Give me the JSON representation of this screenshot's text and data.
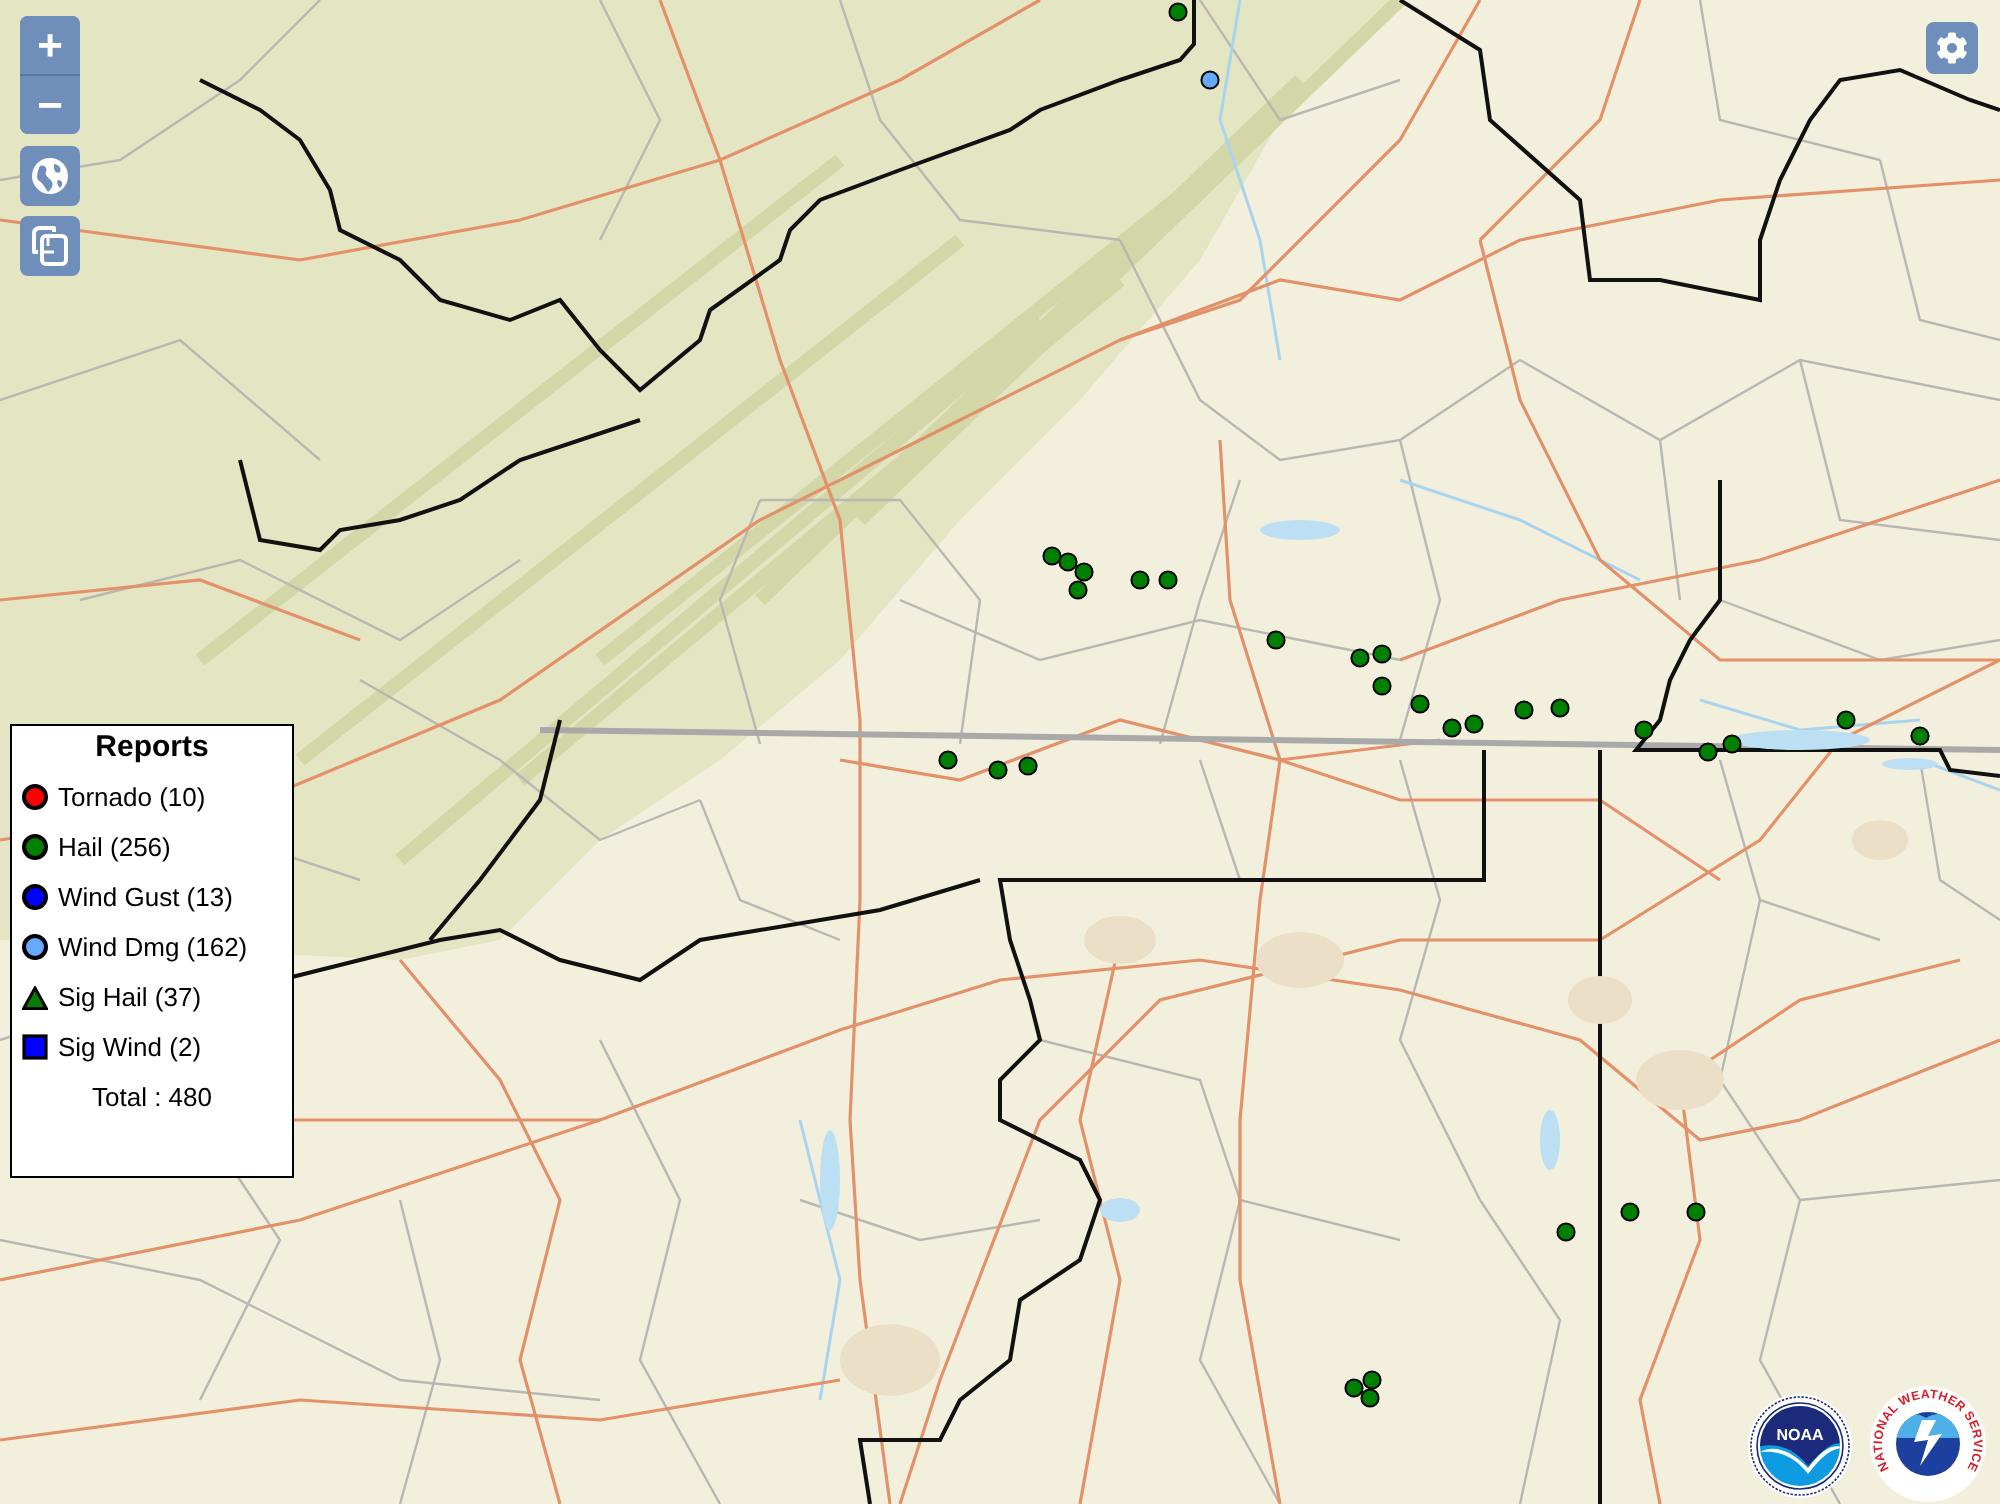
{
  "map_controls": {
    "zoom_in": "+",
    "zoom_out": "−"
  },
  "legend": {
    "title": "Reports",
    "items": [
      {
        "label": "Tornado (10)",
        "kind": "circle",
        "color": "#ff0000"
      },
      {
        "label": "Hail (256)",
        "kind": "circle",
        "color": "#008000"
      },
      {
        "label": "Wind Gust (13)",
        "kind": "circle",
        "color": "#0000ff"
      },
      {
        "label": "Wind Dmg (162)",
        "kind": "circle",
        "color": "#66aaff"
      },
      {
        "label": "Sig Hail (37)",
        "kind": "triangle",
        "color": "#008000"
      },
      {
        "label": "Sig Wind (2)",
        "kind": "square",
        "color": "#0000ff"
      }
    ],
    "total": "Total : 480"
  },
  "noaa_logo": {
    "text": "NOAA"
  },
  "nws_logo": {
    "text": "NATIONAL WEATHER SERVICE"
  }
}
